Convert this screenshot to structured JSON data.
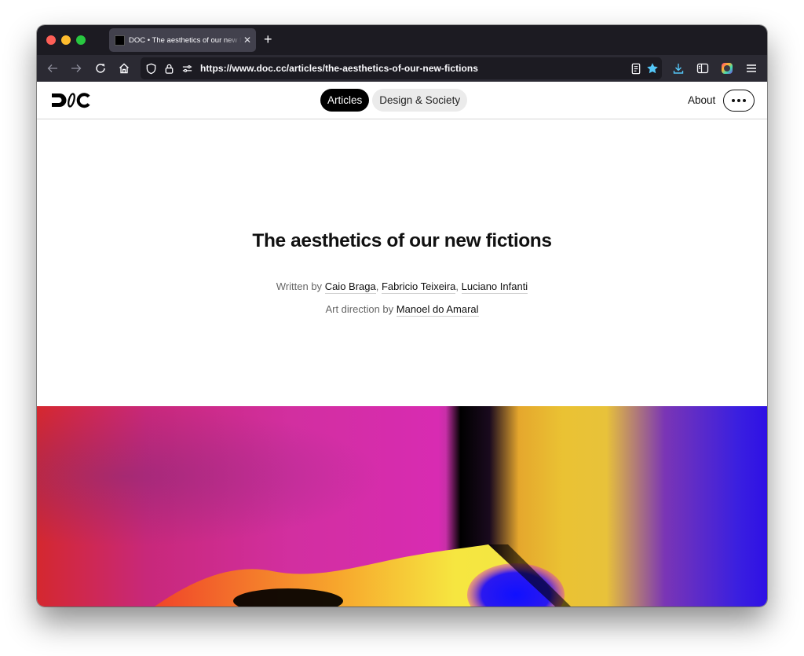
{
  "browser": {
    "tab": {
      "title": "DOC • The aesthetics of our new fictions",
      "close_icon": "close-icon"
    },
    "new_tab_label": "+",
    "url": "https://www.doc.cc/articles/the-aesthetics-of-our-new-fictions",
    "nav": {
      "back_icon": "arrow-left-icon",
      "forward_icon": "arrow-right-icon",
      "reload_icon": "reload-icon",
      "home_icon": "home-icon"
    },
    "url_icons": [
      "shield-icon",
      "lock-icon",
      "permissions-icon"
    ],
    "toolbar_icons": [
      "reader-view-icon",
      "bookmark-star-icon",
      "download-icon",
      "sidebar-icon",
      "profile-icon",
      "menu-icon"
    ],
    "accent_color": "#54c6f7"
  },
  "site": {
    "logo": "DOC",
    "nav": [
      {
        "label": "Articles",
        "active": true
      },
      {
        "label": "Design & Society",
        "active": false
      }
    ],
    "about_label": "About",
    "more_icon": "more-dots-icon"
  },
  "article": {
    "title": "The aesthetics of our new fictions",
    "written_by_prefix": "Written by",
    "authors": [
      "Caio Braga",
      "Fabricio Teixeira",
      "Luciano Infanti"
    ],
    "art_direction_prefix": "Art direction by",
    "art_director": "Manoel do Amaral"
  }
}
